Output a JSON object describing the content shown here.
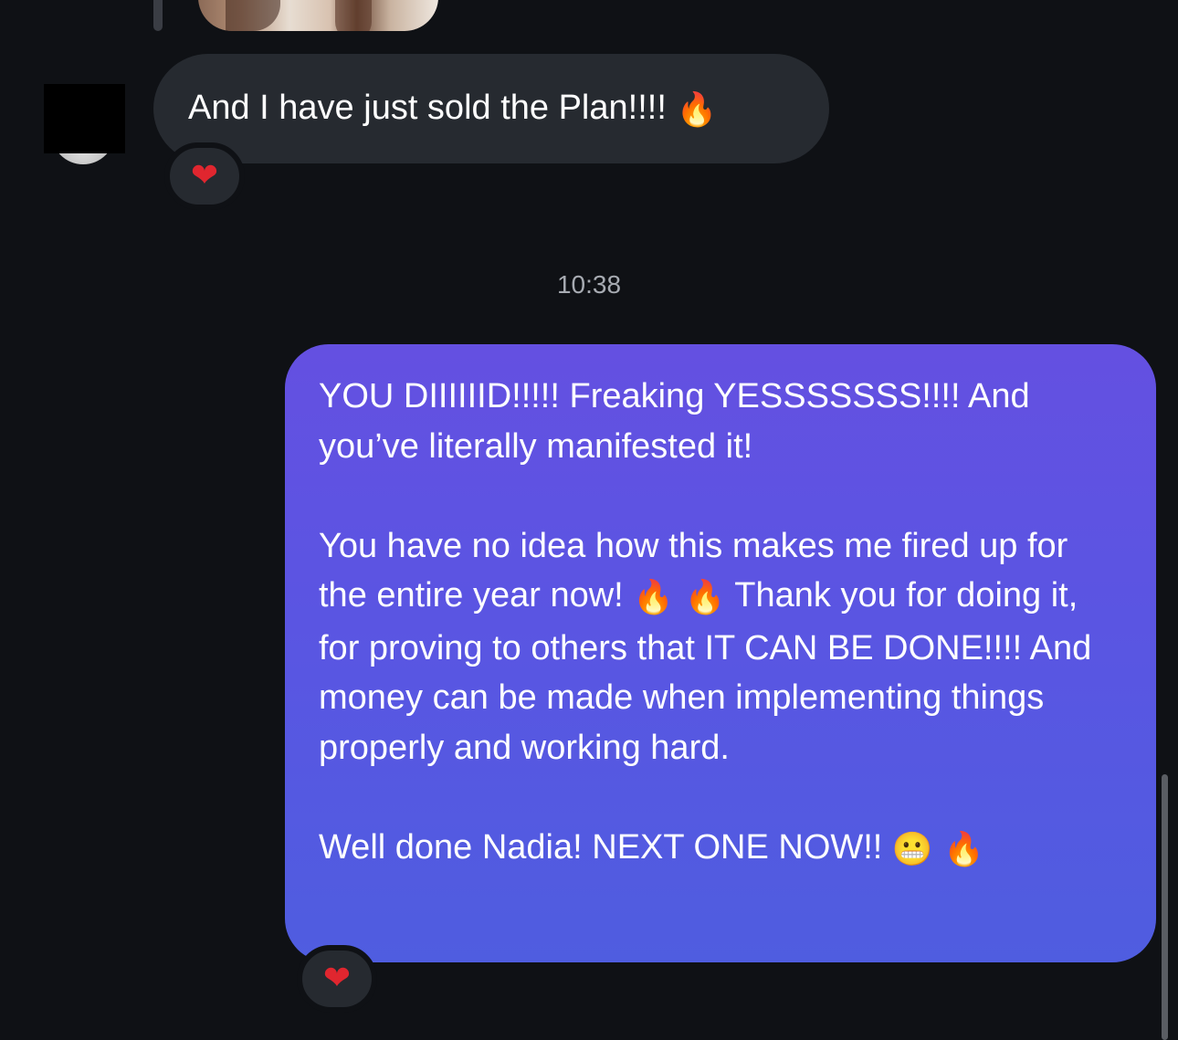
{
  "conversation": {
    "incoming": {
      "text": "And I have just sold the Plan!!!!",
      "emoji": "🔥",
      "reaction": "❤"
    },
    "timestamp": "10:38",
    "outgoing": {
      "paragraph1": "YOU DIIIIIID!!!!! Freaking YESSSSSSS!!!! And you’ve literally manifested it!",
      "paragraph2_part1": "You have no idea how this makes me fired up for the entire year now!",
      "paragraph2_emoji": "🔥 🔥",
      "paragraph2_part2": "Thank you for doing it, for proving to others that IT CAN BE DONE!!!! And money can be made when implementing things properly and working hard.",
      "paragraph3": "Well done Nadia! NEXT ONE NOW!!",
      "paragraph3_emoji": "😬 🔥",
      "reaction": "❤"
    }
  },
  "colors": {
    "background": "#0f1115",
    "incoming_bubble": "#262a30",
    "outgoing_bubble_top": "#6450e1",
    "outgoing_bubble_bottom": "#4f5de0",
    "timestamp": "#a7abb2",
    "heart": "#e0262f"
  }
}
